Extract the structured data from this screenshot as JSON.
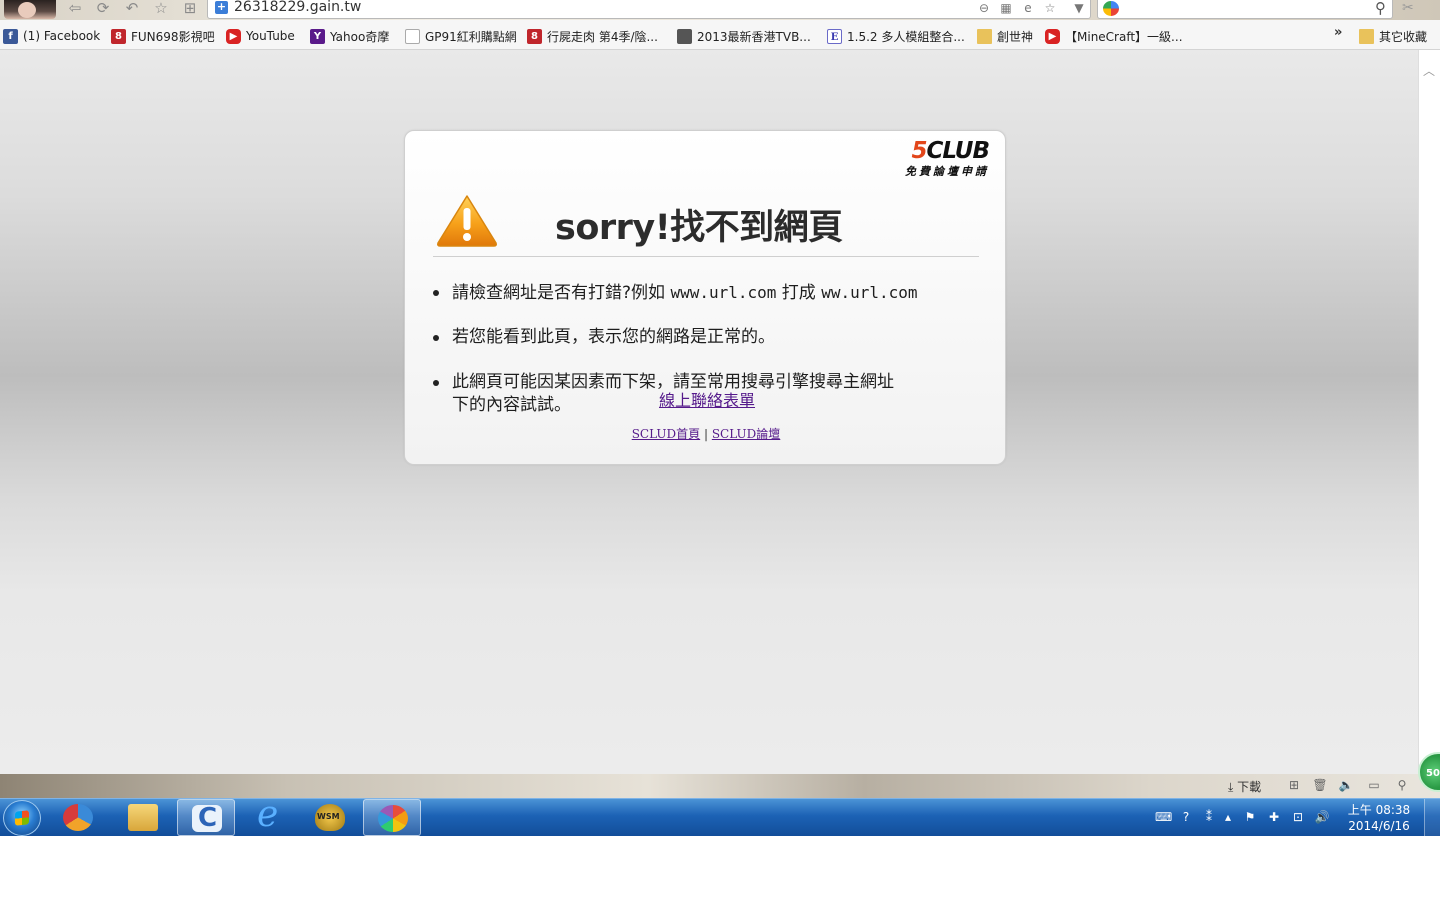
{
  "browser": {
    "url": "26318229.gain.tw",
    "nav": {
      "back": "⇦",
      "forward": "⟳",
      "undo": "↶",
      "star": "☆",
      "grid": "⊞"
    },
    "bookmarks": [
      {
        "label": "(1) Facebook",
        "icon": "f"
      },
      {
        "label": "FUN698影視吧",
        "icon": "8"
      },
      {
        "label": "YouTube",
        "icon": "▶"
      },
      {
        "label": "Yahoo奇摩",
        "icon": "Y"
      },
      {
        "label": "GP91紅利購點網",
        "icon": ""
      },
      {
        "label": "行屍走肉 第4季/陰...",
        "icon": "8"
      },
      {
        "label": "2013最新香港TVB...",
        "icon": ""
      },
      {
        "label": "1.5.2 多人模組整合...",
        "icon": "E"
      },
      {
        "label": "創世神",
        "icon": ""
      },
      {
        "label": "【MineCraft】一級...",
        "icon": "▶"
      }
    ],
    "bookmarks_more": "»",
    "other_bookmarks": "其它收藏"
  },
  "page": {
    "logo": {
      "main": "CLUB",
      "s": "5",
      "sub": "免費論壇申請"
    },
    "title": "sorry!找不到網頁",
    "tips": {
      "tip1_prefix": "請檢查網址是否有打錯?例如 ",
      "tip1_url1": "www.url.com",
      "tip1_mid": " 打成 ",
      "tip1_url2": "ww.url.com",
      "tip2": "若您能看到此頁，表示您的網路是正常的。",
      "tip3_line1": "此網頁可能因某因素而下架，請至常用搜尋引擎搜尋主網址",
      "tip3_line2": "下的內容試試。"
    },
    "contact_link": "線上聯絡表單",
    "footer": {
      "home": "SCLUD首頁",
      "sep": " | ",
      "forum": "SCLUD論壇"
    }
  },
  "status": {
    "download_label": "下載",
    "speed": "50"
  },
  "taskbar": {
    "clock_period_time": "上午 08:38",
    "clock_date": "2014/6/16"
  }
}
